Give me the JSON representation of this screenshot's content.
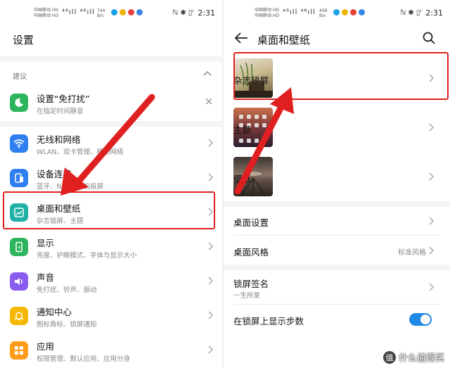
{
  "colors": {
    "accent": "#1e88e5",
    "highlight": "#e02020",
    "toggle_on": "#1e88e5",
    "green": "#2db55d",
    "blue": "#2f7ff0",
    "teal": "#21b0a6",
    "purple": "#8a5cf0",
    "yellow": "#f5b800",
    "orange": "#ff9d1b"
  },
  "status_left": {
    "carrier1": "中国移动 HD",
    "carrier2": "中国移动 HD",
    "signal": "⁴⁶ıll ⁴⁶ıll",
    "speed_value": "744",
    "speed_unit": "B/s",
    "tray": "ℕ ✱ ▯ᴵ",
    "time": "2:31"
  },
  "status_right": {
    "carrier1": "中国移动 HD",
    "carrier2": "中国移动 HD",
    "signal": "⁴⁶ıll ⁴⁶ıll",
    "speed_value": "458",
    "speed_unit": "B/s",
    "tray": "ℕ ✱ ▯ᴵ",
    "time": "2:31"
  },
  "left": {
    "title": "设置",
    "suggest_label": "建议",
    "suggestion": {
      "title": "设置“免打扰”",
      "sub": "在指定时间静音",
      "icon": "moon-icon"
    },
    "items": [
      {
        "title": "无线和网络",
        "sub": "WLAN、双卡管理、移动网络",
        "icon": "wifi-icon"
      },
      {
        "title": "设备连接",
        "sub": "蓝牙、NFC、手机投屏",
        "icon": "device-connect-icon"
      },
      {
        "title": "桌面和壁纸",
        "sub": "杂志锁屏、主题",
        "icon": "wallpaper-icon"
      },
      {
        "title": "显示",
        "sub": "亮度、护眼模式、字体与显示大小",
        "icon": "display-icon"
      },
      {
        "title": "声音",
        "sub": "免打扰、铃声、振动",
        "icon": "sound-icon"
      },
      {
        "title": "通知中心",
        "sub": "图标角标、锁屏通知",
        "icon": "bell-icon"
      },
      {
        "title": "应用",
        "sub": "权限管理、默认应用、应用分身",
        "icon": "apps-icon"
      }
    ]
  },
  "right": {
    "title": "桌面和壁纸",
    "thumb_items": [
      {
        "title": "杂志锁屏"
      },
      {
        "title": "主题"
      },
      {
        "title": "壁纸"
      }
    ],
    "desktop_settings": "桌面设置",
    "desktop_style": {
      "title": "桌面风格",
      "value": "标准风格"
    },
    "lock_signature": {
      "title": "锁屏签名",
      "sub": "一生所爱"
    },
    "show_steps": {
      "title": "在锁屏上显示步数",
      "on": true
    }
  },
  "watermark": {
    "badge": "值",
    "text": "什么值得买"
  }
}
